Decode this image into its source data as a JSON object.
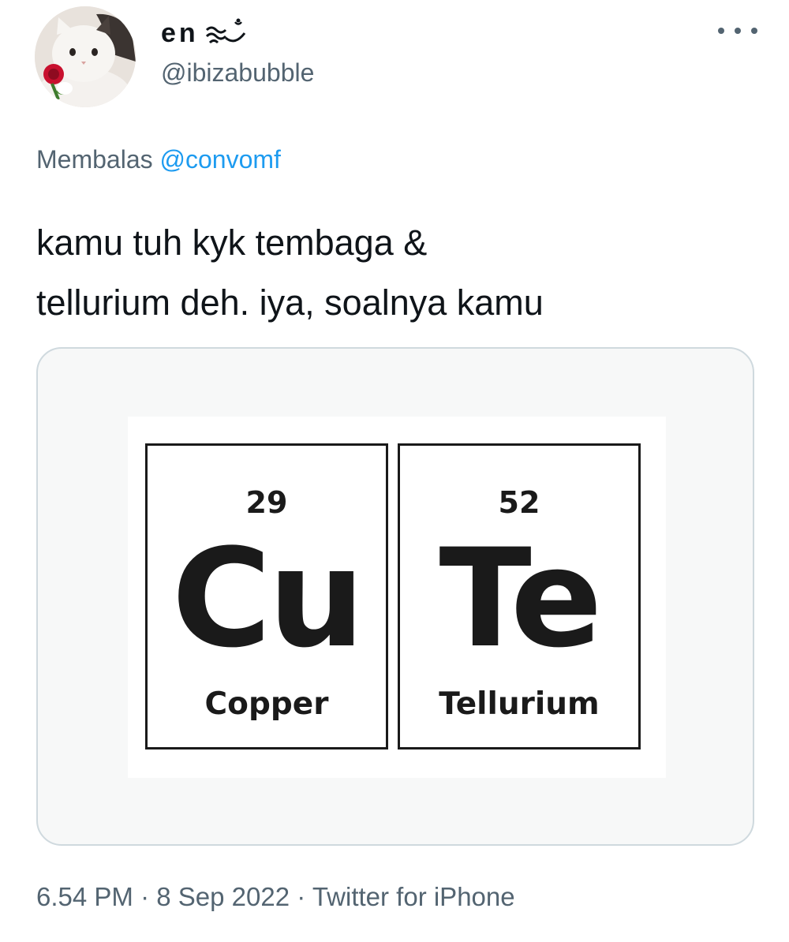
{
  "author": {
    "display_name": "en",
    "handle": "@ibizabubble",
    "avatar": "cat-holding-rose-avatar"
  },
  "reply_context": {
    "prefix": "Membalas",
    "mention": "@convomf"
  },
  "tweet": {
    "text_lines": [
      "kamu tuh kyk tembaga &",
      "tellurium deh. iya, soalnya kamu"
    ]
  },
  "media": {
    "elements": [
      {
        "number": "29",
        "symbol": "Cu",
        "name": "Copper"
      },
      {
        "number": "52",
        "symbol": "Te",
        "name": "Tellurium"
      }
    ]
  },
  "meta": {
    "time": "6.54 PM",
    "separator": "·",
    "date": "8 Sep 2022",
    "source": "Twitter for iPhone"
  },
  "colors": {
    "text_primary": "#0f1419",
    "text_secondary": "#536471",
    "accent": "#1d9bf0",
    "border": "#cfd9de"
  },
  "icons": {
    "more": "more-dots-icon"
  }
}
